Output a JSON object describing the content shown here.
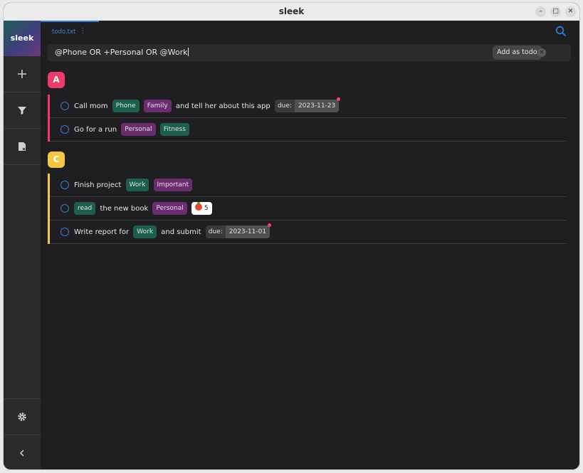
{
  "window": {
    "title": "sleek"
  },
  "sidebar": {
    "logo": "sleek",
    "items": [
      {
        "icon": "plus-icon"
      },
      {
        "icon": "filter-icon"
      },
      {
        "icon": "archive-file-icon"
      },
      {
        "icon": "gear-icon"
      },
      {
        "icon": "chevron-left-icon"
      }
    ]
  },
  "file": {
    "name": "todo.txt",
    "menu": "⋮"
  },
  "search": {
    "query": "@Phone OR +Personal OR @Work",
    "add_label": "Add as todo",
    "clear": "✕"
  },
  "groups": [
    {
      "priority": "A",
      "color": "#f03a6a",
      "todos": [
        {
          "text1": "Call mom",
          "ctx": "Phone",
          "proj": "Family",
          "text2": "and tell her about this app",
          "due_key": "due:",
          "due": "2023-11-23"
        },
        {
          "text1": "Go for a run",
          "proj": "Personal",
          "ctx": "Fitness"
        }
      ]
    },
    {
      "priority": "C",
      "color": "#f4c743",
      "todos": [
        {
          "text1": "Finish project",
          "ctx": "Work",
          "proj": "Important"
        },
        {
          "ctx": "read",
          "text1": "the new book",
          "proj": "Personal",
          "pomodoro": "5"
        },
        {
          "text1": "Write report for",
          "ctx": "Work",
          "text2": "and submit",
          "due_key": "due:",
          "due": "2023-11-01"
        }
      ]
    }
  ]
}
